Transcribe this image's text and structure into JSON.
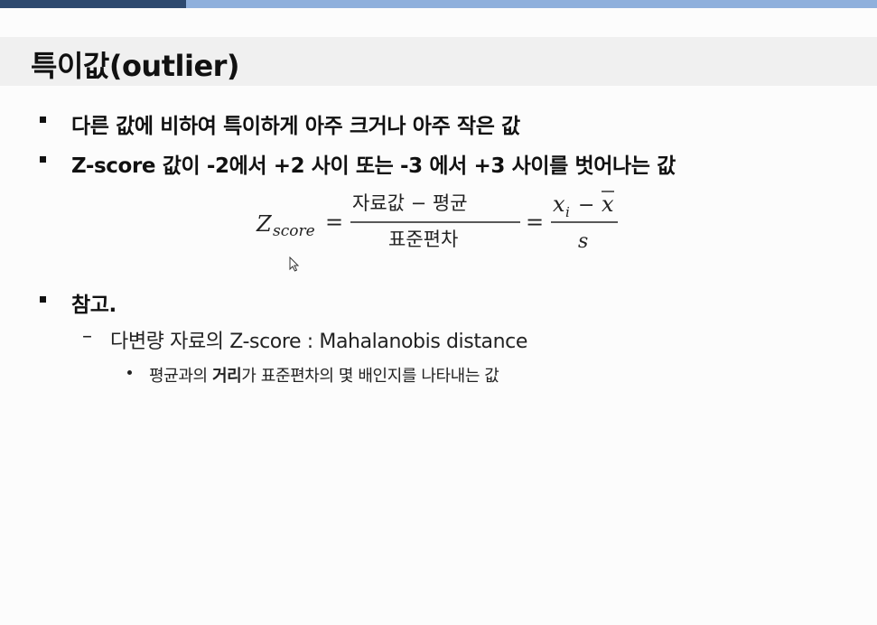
{
  "colors": {
    "bar_dark": "#2e4a6f",
    "bar_light": "#8fb0dc",
    "title_band": "#f0f0f0"
  },
  "title": "특이값(outlier)",
  "bullets": [
    "다른 값에 비하여 특이하게 아주 크거나 아주 작은 값",
    "Z-score 값이 -2에서 +2 사이 또는 -3 에서 +3 사이를 벗어나는 값"
  ],
  "formula": {
    "lhs_main": "Z",
    "lhs_sub": "score",
    "eq": "=",
    "frac1_num": "자료값 − 평균",
    "frac1_den": "표준편차",
    "frac2_num_x": "x",
    "frac2_num_sub": "i",
    "frac2_num_minus": "−",
    "frac2_num_xbar": "x",
    "frac2_den": "s"
  },
  "reference": {
    "heading": "참고.",
    "dash": "–",
    "sub_item": "다변량 자료의 Z-score : Mahalanobis distance",
    "sub_sub_before": "평균과의 ",
    "sub_sub_bold": "거리",
    "sub_sub_after": "가 표준편차의 몇 배인지를 나타내는 값"
  },
  "icons": {
    "cursor": "mouse-cursor-icon"
  }
}
